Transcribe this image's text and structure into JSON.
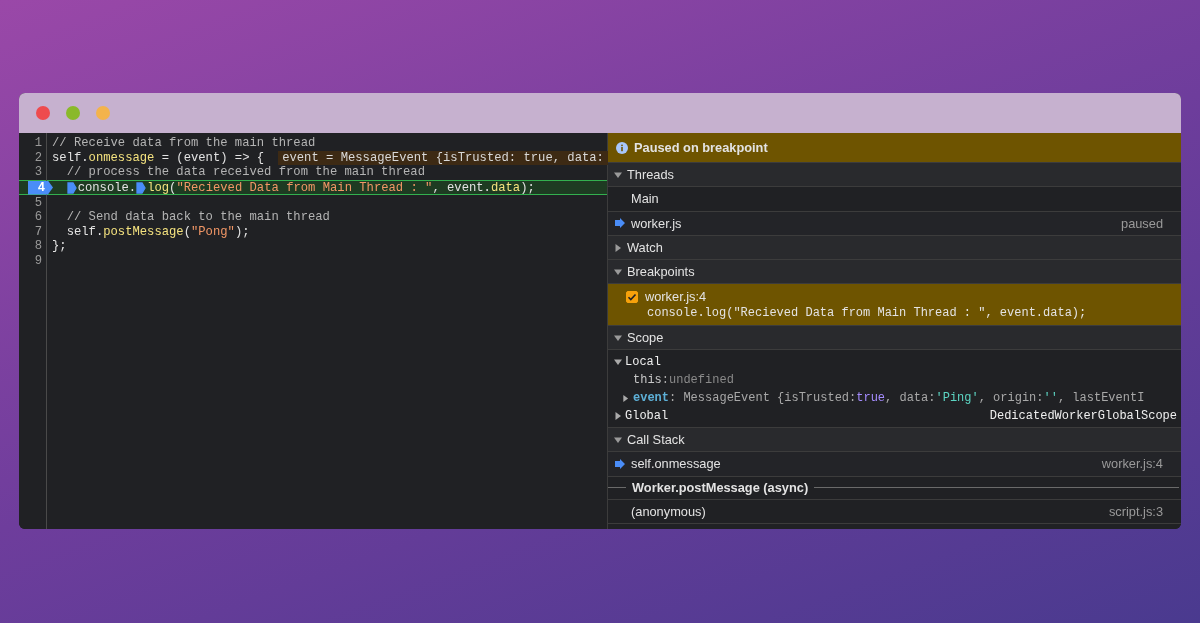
{
  "editor": {
    "lines": [
      {
        "number": "1",
        "current": false,
        "breakpoint": false,
        "tokens": [
          {
            "kind": "comment",
            "text": "// Receive data from the main thread"
          }
        ]
      },
      {
        "number": "2",
        "current": false,
        "breakpoint": false,
        "tokens": [
          {
            "kind": "plain",
            "text": "self."
          },
          {
            "kind": "prop",
            "text": "onmessage"
          },
          {
            "kind": "plain",
            "text": " = (event) => {"
          }
        ],
        "inline_value": "event = MessageEvent {isTrusted: true, data:"
      },
      {
        "number": "3",
        "current": false,
        "breakpoint": false,
        "tokens": [
          {
            "kind": "comment",
            "text": "  // process the data received from the main thread"
          }
        ]
      },
      {
        "number": "4",
        "current": true,
        "breakpoint": true,
        "tokens": [
          {
            "kind": "marker"
          },
          {
            "kind": "plain",
            "text": "console."
          },
          {
            "kind": "marker"
          },
          {
            "kind": "prop",
            "text": "log"
          },
          {
            "kind": "plain",
            "text": "("
          },
          {
            "kind": "string",
            "text": "\"Recieved Data from Main Thread : \""
          },
          {
            "kind": "plain",
            "text": ", event."
          },
          {
            "kind": "prop",
            "text": "data"
          },
          {
            "kind": "plain",
            "text": ");"
          }
        ]
      },
      {
        "number": "5",
        "current": false,
        "breakpoint": false
      },
      {
        "number": "6",
        "current": false,
        "breakpoint": false,
        "tokens": [
          {
            "kind": "comment",
            "text": "  // Send data back to the main thread"
          }
        ]
      },
      {
        "number": "7",
        "current": false,
        "breakpoint": false,
        "tokens": [
          {
            "kind": "plain",
            "text": "  self."
          },
          {
            "kind": "prop",
            "text": "postMessage"
          },
          {
            "kind": "plain",
            "text": "("
          },
          {
            "kind": "string",
            "text": "\"Pong\""
          },
          {
            "kind": "plain",
            "text": ");"
          }
        ]
      },
      {
        "number": "8",
        "current": false,
        "breakpoint": false,
        "tokens": [
          {
            "kind": "plain",
            "text": "};"
          }
        ]
      },
      {
        "number": "9",
        "current": false,
        "breakpoint": false
      }
    ]
  },
  "banner": {
    "text": "Paused on breakpoint"
  },
  "sections": [
    {
      "kind": "threads",
      "title": "Threads",
      "expanded": true,
      "threads": [
        {
          "name": "Main",
          "current": false
        },
        {
          "name": "worker.js",
          "current": true,
          "status": "paused"
        }
      ]
    },
    {
      "title": "Watch",
      "expanded": false
    },
    {
      "kind": "breakpoints",
      "title": "Breakpoints",
      "expanded": true,
      "breakpoints": [
        {
          "location": "worker.js:4",
          "code": "console.log(\"Recieved Data from Main Thread : \", event.data);",
          "checked": true,
          "hit": true
        }
      ]
    },
    {
      "kind": "scope",
      "title": "Scope",
      "expanded": true,
      "scopes": [
        {
          "name": "Local",
          "expanded": true,
          "entries": [
            {
              "name": "this",
              "expandable": false,
              "tokens": [
                {
                  "kind": "plain",
                  "text": ": "
                },
                {
                  "kind": "undefined",
                  "text": "undefined"
                }
              ]
            },
            {
              "name": "event",
              "expandable": true,
              "expanded": false,
              "tokens": [
                {
                  "kind": "plain",
                  "text": ": MessageEvent {isTrusted: "
                },
                {
                  "kind": "keyword",
                  "text": "true"
                },
                {
                  "kind": "plain",
                  "text": ", data: "
                },
                {
                  "kind": "string",
                  "text": "'Ping'"
                },
                {
                  "kind": "plain",
                  "text": ", origin: "
                },
                {
                  "kind": "string",
                  "text": "''"
                },
                {
                  "kind": "plain",
                  "text": ", lastEventI"
                }
              ]
            }
          ]
        },
        {
          "name": "Global",
          "expanded": false,
          "value": "DedicatedWorkerGlobalScope"
        }
      ]
    },
    {
      "kind": "call_stack",
      "title": "Call Stack",
      "expanded": true,
      "frames": [
        {
          "kind": "frame",
          "name": "self.onmessage",
          "location": "worker.js:4",
          "current": true
        },
        {
          "kind": "async",
          "name": "Worker.postMessage (async)"
        },
        {
          "kind": "frame",
          "name": "(anonymous)",
          "location": "script.js:3",
          "current": false
        }
      ]
    }
  ]
}
